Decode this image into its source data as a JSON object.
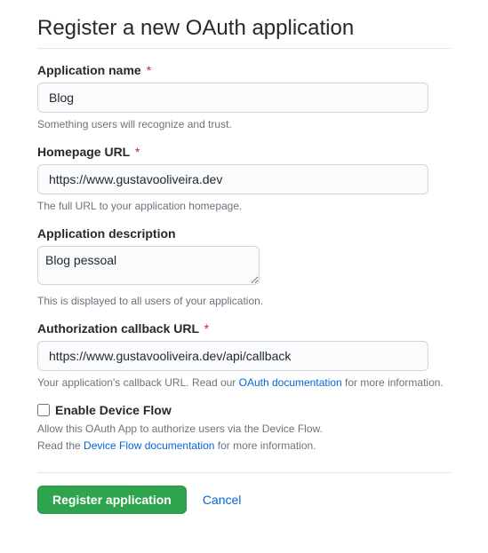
{
  "page": {
    "title": "Register a new OAuth application"
  },
  "fields": {
    "appName": {
      "label": "Application name",
      "required": "*",
      "value": "Blog",
      "help": "Something users will recognize and trust."
    },
    "homepage": {
      "label": "Homepage URL",
      "required": "*",
      "value": "https://www.gustavooliveira.dev",
      "help": "The full URL to your application homepage."
    },
    "description": {
      "label": "Application description",
      "value": "Blog pessoal",
      "help": "This is displayed to all users of your application."
    },
    "callback": {
      "label": "Authorization callback URL",
      "required": "*",
      "value": "https://www.gustavooliveira.dev/api/callback",
      "helpPrefix": "Your application's callback URL. Read our ",
      "helpLink": "OAuth documentation",
      "helpSuffix": " for more information."
    },
    "deviceFlow": {
      "label": "Enable Device Flow",
      "helpLine1": "Allow this OAuth App to authorize users via the Device Flow.",
      "helpLine2Prefix": "Read the ",
      "helpLine2Link": "Device Flow documentation",
      "helpLine2Suffix": " for more information."
    }
  },
  "actions": {
    "register": "Register application",
    "cancel": "Cancel"
  }
}
